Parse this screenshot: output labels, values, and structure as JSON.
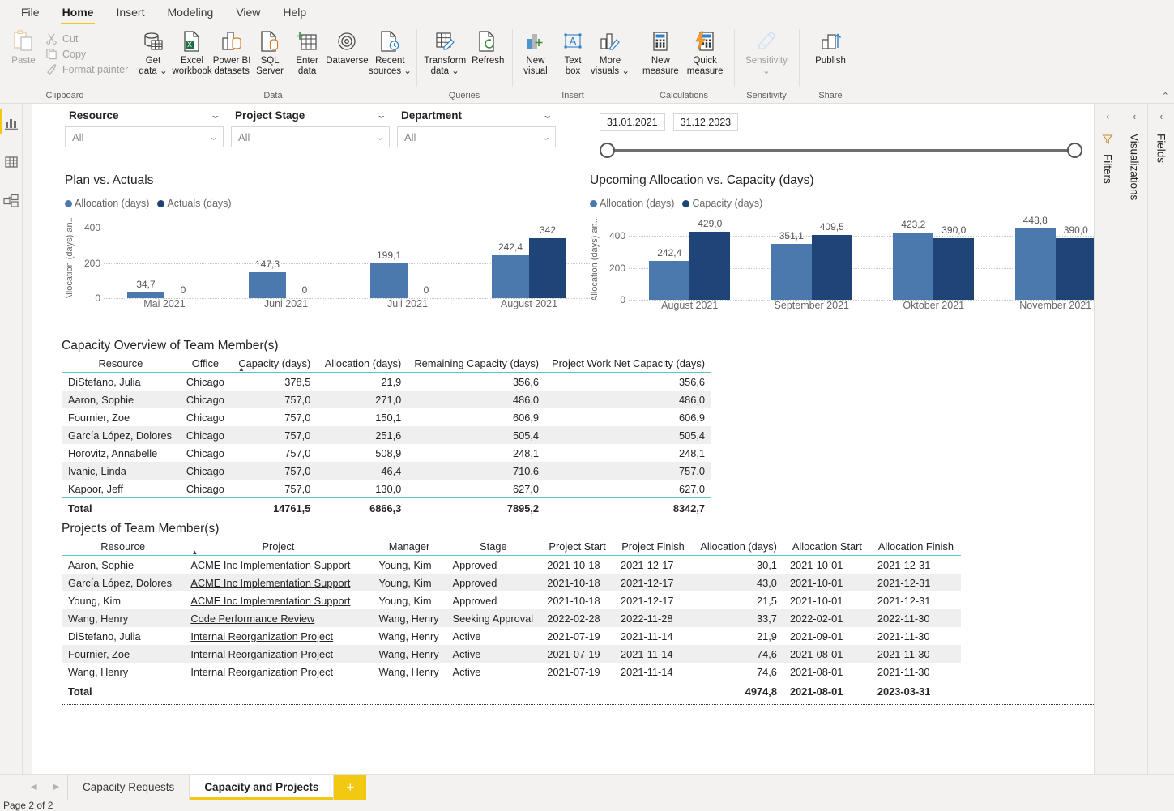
{
  "ribbon": {
    "tabs": [
      {
        "label": "File",
        "active": false
      },
      {
        "label": "Home",
        "active": true
      },
      {
        "label": "Insert",
        "active": false
      },
      {
        "label": "Modeling",
        "active": false
      },
      {
        "label": "View",
        "active": false
      },
      {
        "label": "Help",
        "active": false
      }
    ],
    "groups": {
      "clipboard": {
        "label": "Clipboard",
        "paste": "Paste",
        "cut": "Cut",
        "copy": "Copy",
        "format_painter": "Format painter"
      },
      "data": {
        "label": "Data",
        "get_data_l1": "Get",
        "get_data_l2": "data ⌄",
        "excel_l1": "Excel",
        "excel_l2": "workbook",
        "pbi_l1": "Power BI",
        "pbi_l2": "datasets",
        "sql_l1": "SQL",
        "sql_l2": "Server",
        "enter_l1": "Enter",
        "enter_l2": "data",
        "dataverse": "Dataverse",
        "recent_l1": "Recent",
        "recent_l2": "sources ⌄"
      },
      "queries": {
        "label": "Queries",
        "transform_l1": "Transform",
        "transform_l2": "data ⌄",
        "refresh": "Refresh"
      },
      "insert": {
        "label": "Insert",
        "new_visual_l1": "New",
        "new_visual_l2": "visual",
        "text_box_l1": "Text",
        "text_box_l2": "box",
        "more_visuals_l1": "More",
        "more_visuals_l2": "visuals ⌄"
      },
      "calculations": {
        "label": "Calculations",
        "new_measure_l1": "New",
        "new_measure_l2": "measure",
        "quick_measure_l1": "Quick",
        "quick_measure_l2": "measure"
      },
      "sensitivity": {
        "label": "Sensitivity",
        "button": "Sensitivity",
        "chevron": "⌄"
      },
      "share": {
        "label": "Share",
        "publish": "Publish"
      }
    },
    "collapse_icon": "⌃"
  },
  "leftbar": {
    "items": [
      {
        "name": "report-view-icon",
        "active": true
      },
      {
        "name": "data-view-icon",
        "active": false
      },
      {
        "name": "model-view-icon",
        "active": false
      }
    ]
  },
  "rightpanels": [
    {
      "title": "Filters",
      "icon": "filter-icon",
      "chevron": "‹"
    },
    {
      "title": "Visualizations",
      "icon": "",
      "chevron": "‹"
    },
    {
      "title": "Fields",
      "icon": "",
      "chevron": "‹"
    }
  ],
  "slicers": [
    {
      "title": "Resource",
      "value": "All"
    },
    {
      "title": "Project Stage",
      "value": "All"
    },
    {
      "title": "Department",
      "value": "All"
    }
  ],
  "date_slicer": {
    "start": "31.01.2021",
    "end": "31.12.2023"
  },
  "chart_data": [
    {
      "type": "bar",
      "title": "Plan vs. Actuals",
      "categories": [
        "Mai 2021",
        "Juni 2021",
        "Juli 2021",
        "August 2021"
      ],
      "series": [
        {
          "name": "Allocation (days)",
          "color": "#4c79ad",
          "values": [
            34.7,
            147.3,
            199.1,
            242.4
          ],
          "labels": [
            "34,7",
            "147,3",
            "199,1",
            "242,4"
          ]
        },
        {
          "name": "Actuals (days)",
          "color": "#1f4477",
          "values": [
            0,
            0,
            0,
            342
          ],
          "labels": [
            "0",
            "0",
            "0",
            "342"
          ]
        }
      ],
      "ylabel": "Allocation (days) an...",
      "xlabel": "",
      "yticks": [
        0,
        200,
        400
      ],
      "ylim": [
        0,
        460
      ],
      "grid": true,
      "legend": "top"
    },
    {
      "type": "bar",
      "title": "Upcoming Allocation vs. Capacity (days)",
      "categories": [
        "August 2021",
        "September 2021",
        "Oktober 2021",
        "November 2021"
      ],
      "series": [
        {
          "name": "Allocation (days)",
          "color": "#4c79ad",
          "values": [
            242.4,
            351.1,
            423.2,
            448.8
          ],
          "labels": [
            "242,4",
            "351,1",
            "423,2",
            "448,8"
          ]
        },
        {
          "name": "Capacity (days)",
          "color": "#1f4477",
          "values": [
            429.0,
            409.5,
            390.0,
            390.0
          ],
          "labels": [
            "429,0",
            "409,5",
            "390,0",
            "390,0"
          ]
        }
      ],
      "ylabel": "Allocation (days) an...",
      "xlabel": "",
      "yticks": [
        0,
        200,
        400
      ],
      "ylim": [
        0,
        520
      ],
      "grid": true,
      "legend": "top"
    }
  ],
  "capacity_table": {
    "title": "Capacity Overview of Team Member(s)",
    "columns": [
      {
        "label": "Resource",
        "align": "left"
      },
      {
        "label": "Office",
        "align": "left"
      },
      {
        "label": "Capacity (days)",
        "align": "right",
        "sorted": true
      },
      {
        "label": "Allocation (days)",
        "align": "right"
      },
      {
        "label": "Remaining Capacity (days)",
        "align": "right"
      },
      {
        "label": "Project Work Net Capacity (days)",
        "align": "right"
      }
    ],
    "rows": [
      [
        "DiStefano, Julia",
        "Chicago",
        "378,5",
        "21,9",
        "356,6",
        "356,6"
      ],
      [
        "Aaron, Sophie",
        "Chicago",
        "757,0",
        "271,0",
        "486,0",
        "486,0"
      ],
      [
        "Fournier, Zoe",
        "Chicago",
        "757,0",
        "150,1",
        "606,9",
        "606,9"
      ],
      [
        "García López, Dolores",
        "Chicago",
        "757,0",
        "251,6",
        "505,4",
        "505,4"
      ],
      [
        "Horovitz, Annabelle",
        "Chicago",
        "757,0",
        "508,9",
        "248,1",
        "248,1"
      ],
      [
        "Ivanic, Linda",
        "Chicago",
        "757,0",
        "46,4",
        "710,6",
        "757,0"
      ],
      [
        "Kapoor, Jeff",
        "Chicago",
        "757,0",
        "130,0",
        "627,0",
        "627,0"
      ]
    ],
    "total": [
      "Total",
      "",
      "14761,5",
      "6866,3",
      "7895,2",
      "8342,7"
    ]
  },
  "projects_table": {
    "title": "Projects of Team Member(s)",
    "columns": [
      {
        "label": "Resource",
        "align": "left"
      },
      {
        "label": "Project",
        "align": "left",
        "sorted": true
      },
      {
        "label": "Manager",
        "align": "left"
      },
      {
        "label": "Stage",
        "align": "left"
      },
      {
        "label": "Project Start",
        "align": "left"
      },
      {
        "label": "Project Finish",
        "align": "left"
      },
      {
        "label": "Allocation (days)",
        "align": "right"
      },
      {
        "label": "Allocation Start",
        "align": "left"
      },
      {
        "label": "Allocation Finish",
        "align": "left"
      }
    ],
    "rows": [
      [
        "Aaron, Sophie",
        "ACME Inc Implementation Support",
        "Young, Kim",
        "Approved",
        "2021-10-18",
        "2021-12-17",
        "30,1",
        "2021-10-01",
        "2021-12-31"
      ],
      [
        "García López, Dolores",
        "ACME Inc Implementation Support",
        "Young, Kim",
        "Approved",
        "2021-10-18",
        "2021-12-17",
        "43,0",
        "2021-10-01",
        "2021-12-31"
      ],
      [
        "Young, Kim",
        "ACME Inc Implementation Support",
        "Young, Kim",
        "Approved",
        "2021-10-18",
        "2021-12-17",
        "21,5",
        "2021-10-01",
        "2021-12-31"
      ],
      [
        "Wang, Henry",
        "Code Performance Review",
        "Wang, Henry",
        "Seeking Approval",
        "2022-02-28",
        "2022-11-28",
        "33,7",
        "2022-02-01",
        "2022-11-30"
      ],
      [
        "DiStefano, Julia",
        "Internal Reorganization Project",
        "Wang, Henry",
        "Active",
        "2021-07-19",
        "2021-11-14",
        "21,9",
        "2021-09-01",
        "2021-11-30"
      ],
      [
        "Fournier, Zoe",
        "Internal Reorganization Project",
        "Wang, Henry",
        "Active",
        "2021-07-19",
        "2021-11-14",
        "74,6",
        "2021-08-01",
        "2021-11-30"
      ],
      [
        "Wang, Henry",
        "Internal Reorganization Project",
        "Wang, Henry",
        "Active",
        "2021-07-19",
        "2021-11-14",
        "74,6",
        "2021-08-01",
        "2021-11-30"
      ]
    ],
    "total": [
      "Total",
      "",
      "",
      "",
      "",
      "",
      "4974,8",
      "2021-08-01",
      "2023-03-31"
    ]
  },
  "footer": {
    "prev_arrow": "◀",
    "next_arrow": "▶",
    "tabs": [
      {
        "label": "Capacity Requests",
        "active": false
      },
      {
        "label": "Capacity and Projects",
        "active": true
      }
    ],
    "add_label": "+",
    "status": "Page 2 of 2"
  },
  "colors": {
    "accent": "#f2c811",
    "series_light": "#4c79ad",
    "series_dark": "#1f4477",
    "table_rule": "#5ec6c6"
  }
}
